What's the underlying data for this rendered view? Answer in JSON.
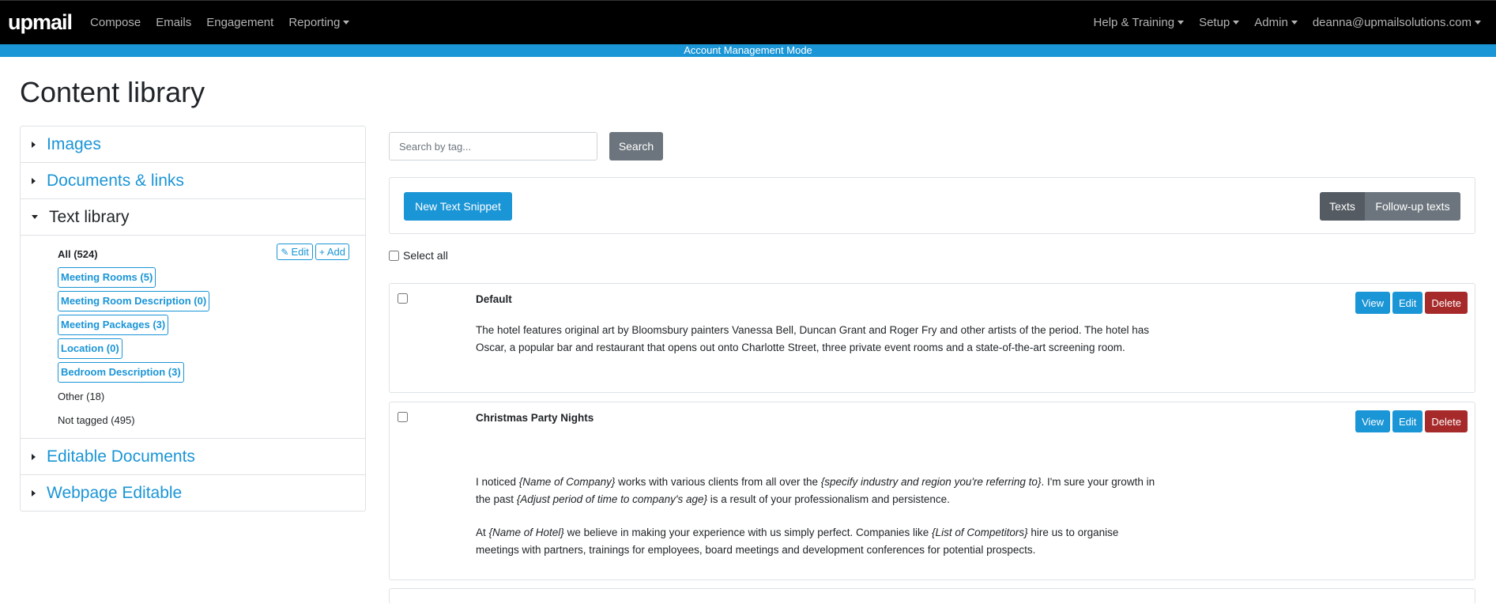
{
  "nav": {
    "logo": "upmail",
    "left_items": [
      "Compose",
      "Emails",
      "Engagement",
      "Reporting"
    ],
    "right_items": [
      "Help & Training",
      "Setup",
      "Admin",
      "deanna@upmailsolutions.com"
    ]
  },
  "mode_banner": "Account Management Mode",
  "page_title": "Content library",
  "sidebar": {
    "sections": {
      "images": "Images",
      "documents": "Documents & links",
      "text_library": "Text library",
      "editable_documents": "Editable Documents",
      "webpage_editable": "Webpage Editable"
    },
    "text_library_tags": {
      "all": "All (524)",
      "tagged": [
        "Meeting Rooms (5)",
        "Meeting Room Description (0)",
        "Meeting Packages (3)",
        "Location (0)",
        "Bedroom Description (3)"
      ],
      "other": "Other (18)",
      "not_tagged": "Not tagged (495)"
    },
    "edit_label": "Edit",
    "add_label": "Add"
  },
  "search": {
    "placeholder": "Search by tag...",
    "button": "Search"
  },
  "toolbar": {
    "new_snippet": "New Text Snippet",
    "tab_texts": "Texts",
    "tab_followups": "Follow-up texts"
  },
  "select_all": "Select all",
  "actions": {
    "view": "View",
    "edit": "Edit",
    "delete": "Delete"
  },
  "items": [
    {
      "title": "Default",
      "body": "The hotel features original art by Bloomsbury painters Vanessa Bell, Duncan Grant and Roger Fry and other artists of the period. The hotel has Oscar, a popular bar and restaurant that opens out onto Charlotte Street, three private event rooms and a state-of-the-art screening room."
    },
    {
      "title": "Christmas Party Nights",
      "p1": [
        "I noticed ",
        "{Name of Company}",
        " works with various clients from all over the ",
        "{specify industry and region you're referring to}",
        ". I'm sure your growth in the past ",
        "{Adjust period of time to company's age}",
        " is a result of your professionalism and persistence."
      ],
      "p2": [
        "At ",
        "{Name of Hotel}",
        " we believe in making your experience with us simply perfect. Companies like ",
        "{List of Competitors}",
        " hire us to organise meetings with partners, trainings for employees, board meetings and development conferences for potential prospects."
      ]
    }
  ],
  "colors": {
    "accent": "#1a95d6",
    "danger": "#a72a2a",
    "secondary": "#6c757d"
  }
}
